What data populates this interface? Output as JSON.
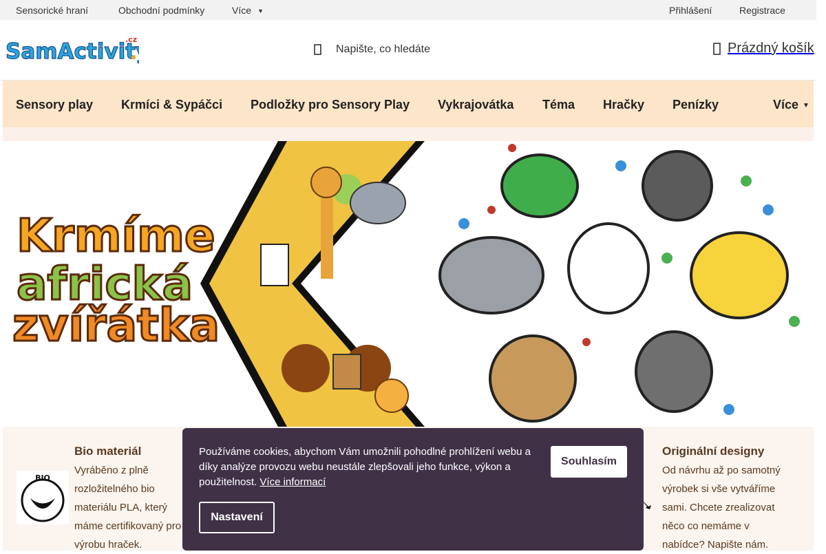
{
  "topbar": {
    "links": [
      "Sensorické hraní",
      "Obchodní podmínky",
      "Více"
    ],
    "login": "Přihlášení",
    "register": "Registrace"
  },
  "header": {
    "logo_text": "SamActivity",
    "logo_tld": ".cz",
    "search_placeholder": "Napište, co hledáte",
    "cart_label": "Prázdný košík"
  },
  "nav": {
    "items": [
      "Sensory play",
      "Krmíci & Sypáčci",
      "Podložky pro Sensory Play",
      "Vykrajovátka",
      "Téma",
      "Hračky",
      "Penízky"
    ],
    "more": "Více"
  },
  "banner": {
    "headline": [
      "Krmíme",
      "africká",
      "zvířátka"
    ]
  },
  "features": {
    "bio": {
      "badge": "BIO",
      "title": "Bio materiál",
      "lines": [
        "Vyráběno z plně",
        "rozložitelného bio",
        "materiálu PLA, který",
        "máme certifikovaný pro",
        "výrobu hraček."
      ]
    },
    "original": {
      "title": "Originální designy",
      "lines": [
        "Od návrhu až po samotný",
        "výrobek si vše vytváříme",
        "sami. Chcete zrealizovat",
        "něco co nemáme v",
        "nabídce? Napište nám."
      ]
    }
  },
  "cookie": {
    "text": "Používáme cookies, abychom Vám umožnili pohodlné prohlížení webu a díky analýze provozu webu neustále zlepšovali jeho funkce, výkon a použitelnost.",
    "more_link": "Více informací",
    "accept": "Souhlasím",
    "settings": "Nastavení"
  },
  "colors": {
    "nav_bg": "#fde5c9",
    "cookie_bg": "#403147",
    "feature_text": "#5a3a1e"
  }
}
